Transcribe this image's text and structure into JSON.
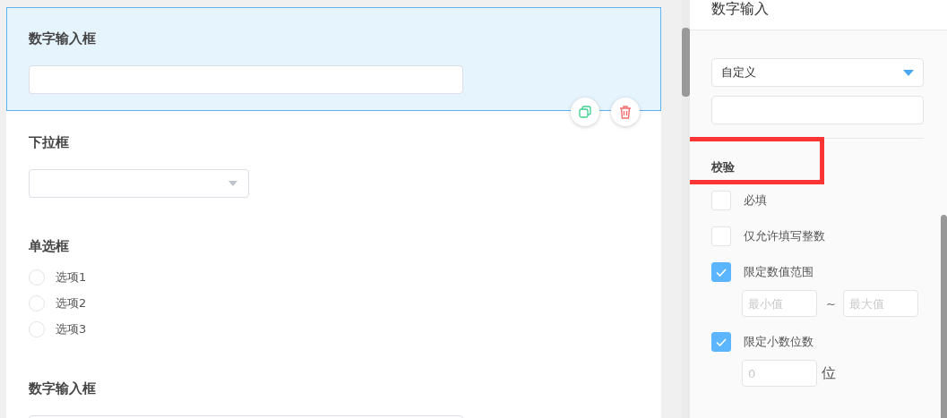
{
  "canvas": {
    "fields": [
      {
        "kind": "number",
        "label": "数字输入框",
        "selected": true
      },
      {
        "kind": "select",
        "label": "下拉框",
        "selected": false
      },
      {
        "kind": "radio",
        "label": "单选框",
        "selected": false,
        "options": [
          {
            "label": "选项1",
            "selected": false
          },
          {
            "label": "选项2",
            "selected": false
          },
          {
            "label": "选项3",
            "selected": false
          }
        ]
      },
      {
        "kind": "number",
        "label": "数字输入框",
        "selected": false
      }
    ]
  },
  "panel": {
    "title": "数字输入",
    "format_select": {
      "value": "自定义"
    },
    "validation": {
      "title": "校验",
      "highlighted": true,
      "rules": [
        {
          "kind": "check",
          "label": "必填",
          "checked": false
        },
        {
          "kind": "check",
          "label": "仅允许填写整数",
          "checked": false
        },
        {
          "kind": "range",
          "label": "限定数值范围",
          "checked": true,
          "min_placeholder": "最小值",
          "separator": "~",
          "max_placeholder": "最大值"
        },
        {
          "kind": "decimal",
          "label": "限定小数位数",
          "checked": true,
          "placeholder": "0",
          "unit": "位"
        }
      ]
    }
  }
}
